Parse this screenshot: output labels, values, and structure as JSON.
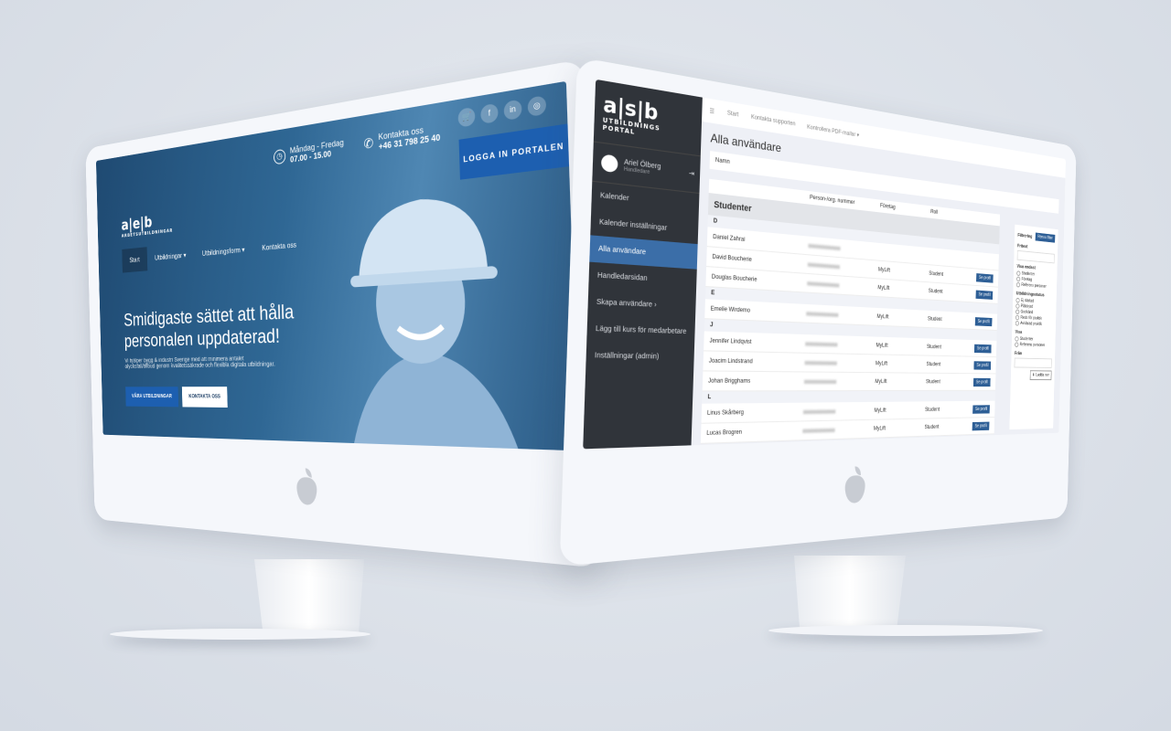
{
  "left_screen": {
    "social": [
      "cart",
      "f",
      "in",
      "ig"
    ],
    "hours_label": "Måndag - Fredag",
    "hours": "07.00 - 15.00",
    "contact_label": "Kontakta oss",
    "phone": "+46 31 798 25 40",
    "login_button": "LOGGA IN PORTALEN",
    "logo": "a|e|b",
    "logo_sub": "ARBETSUTBILDNINGAR",
    "nav": [
      "Start",
      "Utbildningar ▾",
      "Utbildningsform ▾",
      "Kontakta oss"
    ],
    "headline": "Smidigaste sättet att hålla personalen uppdaterad!",
    "paragraph": "Vi hjälper bygg & industri Sverige med att minimera antalet olycksfall/tillbud genom kvalitetssäkrade och flexibla digitala utbildningar.",
    "primary_button": "VÅRA UTBILDNINGAR",
    "secondary_button": "KONTAKTA OSS",
    "colors": {
      "hero": "#2f6794",
      "accent": "#1d5fb0"
    }
  },
  "right_screen": {
    "logo": "a|s|b",
    "logo_sub": "UTBILDNINGS PORTAL",
    "user": {
      "name": "Ariel Ölberg",
      "role": "Handledare"
    },
    "menu": [
      "Kalender",
      "Kalender inställningar",
      "Alla användare",
      "Handledarsidan",
      "Skapa användare  ›",
      "Lägg till kurs för medarbetare",
      "Inställningar (admin)"
    ],
    "active_menu": 2,
    "topnav": [
      "☰",
      "Start",
      "Kontakta supporten",
      "Kontrollera PDF-mallar ▾"
    ],
    "title": "Alla användare",
    "filter_label": "Namn",
    "columns": [
      "Person-/org. nummer",
      "Företag",
      "Roll"
    ],
    "section": "Studenter",
    "groups": [
      {
        "letter": "D",
        "rows": [
          {
            "name": "Daniel Zahrai",
            "company": "",
            "role": ""
          },
          {
            "name": "David Boucherie",
            "company": "MyLift",
            "role": "Student"
          },
          {
            "name": "Douglas Boucherie",
            "company": "MyLift",
            "role": "Student"
          }
        ]
      },
      {
        "letter": "E",
        "rows": [
          {
            "name": "Emelie Wirdemo",
            "company": "MyLift",
            "role": "Student"
          }
        ]
      },
      {
        "letter": "J",
        "rows": [
          {
            "name": "Jennifer Lindqvist",
            "company": "MyLift",
            "role": "Student"
          },
          {
            "name": "Joacim Lindstrand",
            "company": "MyLift",
            "role": "Student"
          },
          {
            "name": "Johan Brigghams",
            "company": "MyLift",
            "role": "Student"
          }
        ]
      },
      {
        "letter": "L",
        "rows": [
          {
            "name": "Linus Skårberg",
            "company": "MyLift",
            "role": "Student"
          },
          {
            "name": "Lucas Brogren",
            "company": "MyLift",
            "role": "Student"
          }
        ]
      }
    ],
    "profile_button": "Se profil",
    "panel": {
      "title": "Filtrering",
      "clear": "Rensa filter",
      "freetext": "Fritext",
      "show_only": "Visa endast",
      "show_only_opts": [
        "Studenter",
        "Företag",
        "Referens personer"
      ],
      "status": "Utbildningsstatus",
      "status_opts": [
        "Ej startad",
        "Påbörjad",
        "Godkänd",
        "Redo för praktik",
        "Avklarad praktik"
      ],
      "show": "Visa",
      "show_opts": [
        "Studenter",
        "Referens personer"
      ],
      "from": "Från",
      "download": "Ladda ner"
    },
    "colors": {
      "sidebar": "#30343a",
      "accent": "#2e5f96"
    }
  }
}
